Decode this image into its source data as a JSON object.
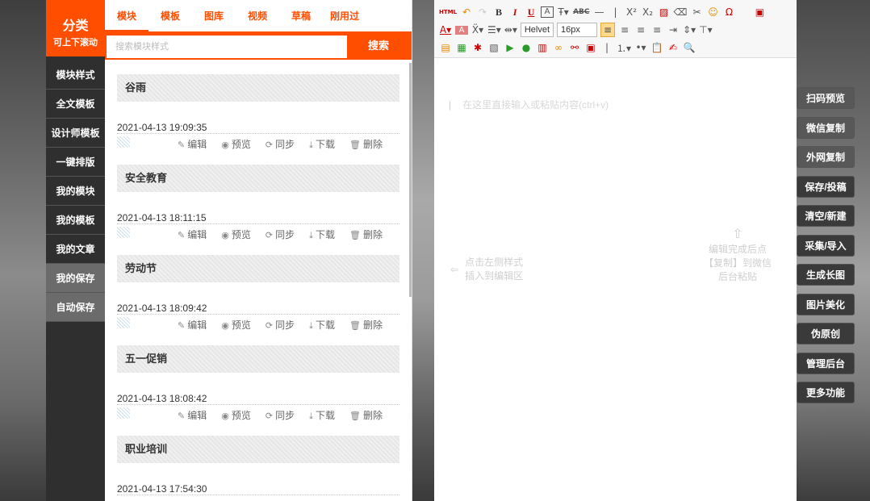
{
  "category": {
    "title": "分类",
    "subtitle": "可上下滚动",
    "items": [
      "模块样式",
      "全文模板",
      "设计师模板",
      "一键排版",
      "我的模块",
      "我的模板",
      "我的文章",
      "我的保存",
      "自动保存"
    ]
  },
  "tabs": [
    "模块",
    "模板",
    "图库",
    "视频",
    "草稿",
    "刚用过"
  ],
  "search": {
    "placeholder": "搜索模块样式",
    "button": "搜索"
  },
  "templates": [
    {
      "title": "谷雨",
      "date": "2021-04-13 19:09:35"
    },
    {
      "title": "安全教育",
      "date": "2021-04-13 18:11:15"
    },
    {
      "title": "劳动节",
      "date": "2021-04-13 18:09:42"
    },
    {
      "title": "五一促销",
      "date": "2021-04-13 18:08:42"
    },
    {
      "title": "职业培训",
      "date": "2021-04-13 17:54:30"
    }
  ],
  "actions": {
    "edit": "编辑",
    "preview": "预览",
    "sync": "同步",
    "download": "下载",
    "delete": "删除"
  },
  "toolbar": {
    "font_family": "Helvet",
    "font_size": "16px",
    "html_label": "HTML",
    "abc_label": "ABC"
  },
  "editor": {
    "placeholder": "在这里直接输入或粘贴内容(ctrl+v)",
    "hint_left_line1": "点击左侧样式",
    "hint_left_line2": "插入到编辑区",
    "hint_right": "编辑完成后点【复制】到微信后台粘贴"
  },
  "functions": [
    "扫码预览",
    "微信复制",
    "外网复制",
    "保存/投稿",
    "清空/新建",
    "采集/导入",
    "生成长图",
    "图片美化",
    "伪原创",
    "管理后台",
    "更多功能"
  ],
  "colors": {
    "accent": "#ff4e00",
    "dark": "#2f2f2f"
  }
}
